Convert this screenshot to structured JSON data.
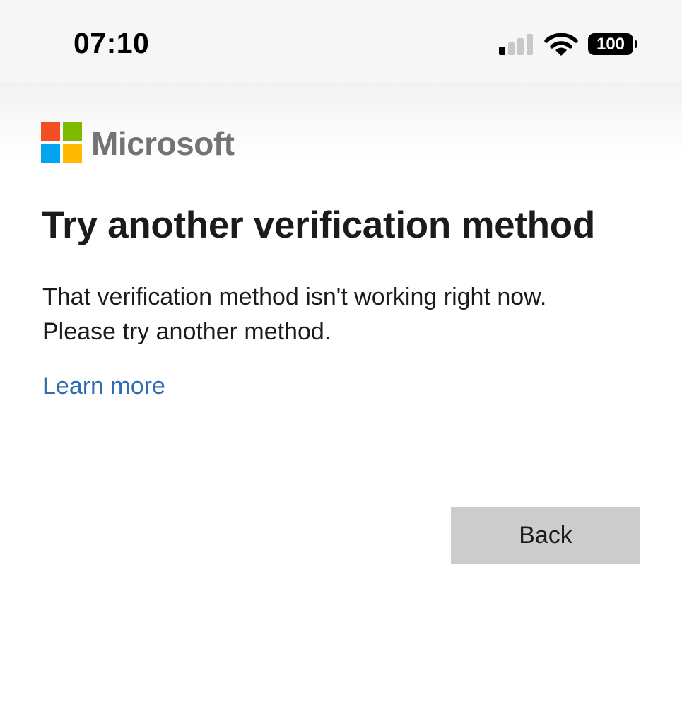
{
  "status_bar": {
    "time": "07:10",
    "battery_level": "100",
    "signal_bars_active": 1,
    "signal_bars_total": 4
  },
  "brand": {
    "name": "Microsoft",
    "logo_colors": [
      "#f25022",
      "#7fba00",
      "#00a4ef",
      "#ffb900"
    ]
  },
  "page": {
    "title": "Try another verification method",
    "message_line1": "That verification method isn't working right now.",
    "message_line2": "Please try another method.",
    "learn_more_label": "Learn more",
    "back_button_label": "Back"
  },
  "colors": {
    "link": "#2f6db3",
    "button_bg": "#cccccc",
    "text": "#1b1b1b"
  }
}
